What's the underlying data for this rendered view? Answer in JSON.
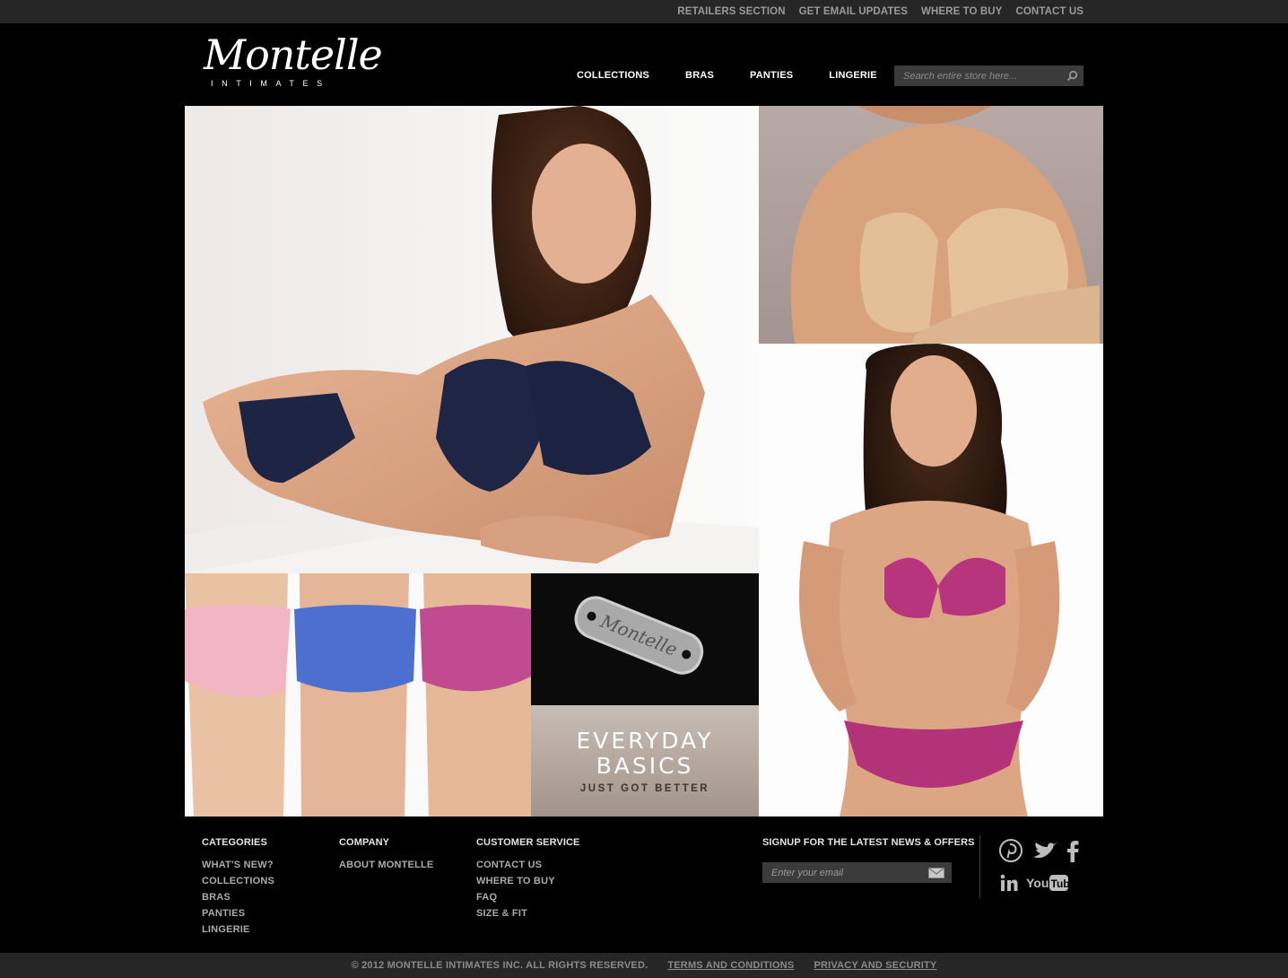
{
  "top_links": [
    "RETAILERS SECTION",
    "GET EMAIL UPDATES",
    "WHERE TO BUY",
    "CONTACT US"
  ],
  "logo": {
    "script": "Montelle",
    "sub": "INTIMATES"
  },
  "nav": [
    "COLLECTIONS",
    "BRAS",
    "PANTIES",
    "LINGERIE"
  ],
  "search": {
    "placeholder": "Search entire store here..."
  },
  "promo": {
    "tag_text": "Montelle",
    "title_line1": "EVERYDAY",
    "title_line2": "BASICS",
    "subtitle": "JUST GOT BETTER"
  },
  "footer": {
    "categories": {
      "heading": "CATEGORIES",
      "links": [
        "WHAT'S NEW?",
        "COLLECTIONS",
        "BRAS",
        "PANTIES",
        "LINGERIE"
      ]
    },
    "company": {
      "heading": "COMPANY",
      "links": [
        "ABOUT MONTELLE"
      ]
    },
    "customer_service": {
      "heading": "CUSTOMER SERVICE",
      "links": [
        "CONTACT US",
        "WHERE TO BUY",
        "FAQ",
        "SIZE & FIT"
      ]
    },
    "signup": {
      "heading": "SIGNUP FOR THE LATEST NEWS & OFFERS",
      "placeholder": "Enter your email"
    },
    "social": [
      "pinterest-icon",
      "twitter-icon",
      "facebook-icon",
      "linkedin-icon",
      "youtube-icon"
    ]
  },
  "bottom": {
    "copyright": "© 2012 MONTELLE INTIMATES INC. ALL RIGHTS RESERVED.",
    "terms": "TERMS AND CONDITIONS",
    "privacy": "PRIVACY AND SECURITY"
  },
  "colors": {
    "background": "#000000",
    "bar": "#262626",
    "field": "#3b3b3b"
  }
}
